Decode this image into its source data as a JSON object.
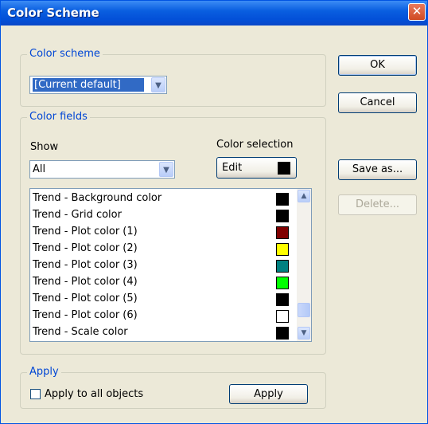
{
  "window": {
    "title": "Color Scheme",
    "close_glyph": "✕"
  },
  "color_scheme_group": {
    "legend": "Color scheme",
    "selected": "[Current default]"
  },
  "color_fields_group": {
    "legend": "Color fields",
    "show_label": "Show",
    "show_selected": "All",
    "color_selection_label": "Color selection",
    "edit_button": "Edit",
    "edit_swatch_color": "#000000",
    "rows": [
      {
        "label": "Trend - Background color",
        "color": "#000000"
      },
      {
        "label": "Trend - Grid color",
        "color": "#000000"
      },
      {
        "label": "Trend - Plot color (1)",
        "color": "#800000"
      },
      {
        "label": "Trend - Plot color (2)",
        "color": "#ffff00"
      },
      {
        "label": "Trend - Plot color (3)",
        "color": "#008080"
      },
      {
        "label": "Trend - Plot color (4)",
        "color": "#00ff00"
      },
      {
        "label": "Trend - Plot color (5)",
        "color": "#000000"
      },
      {
        "label": "Trend - Plot color (6)",
        "color": "#ffffff"
      },
      {
        "label": "Trend - Scale color",
        "color": "#000000"
      }
    ]
  },
  "apply_group": {
    "legend": "Apply",
    "checkbox_label": "Apply to all objects",
    "checked": false,
    "apply_button": "Apply"
  },
  "buttons": {
    "ok": "OK",
    "cancel": "Cancel",
    "save_as": "Save as...",
    "delete": "Delete..."
  },
  "icons": {
    "dropdown": "chevron-down-icon",
    "scroll_up": "chevron-up-icon",
    "scroll_down": "chevron-down-icon",
    "close": "close-icon"
  }
}
